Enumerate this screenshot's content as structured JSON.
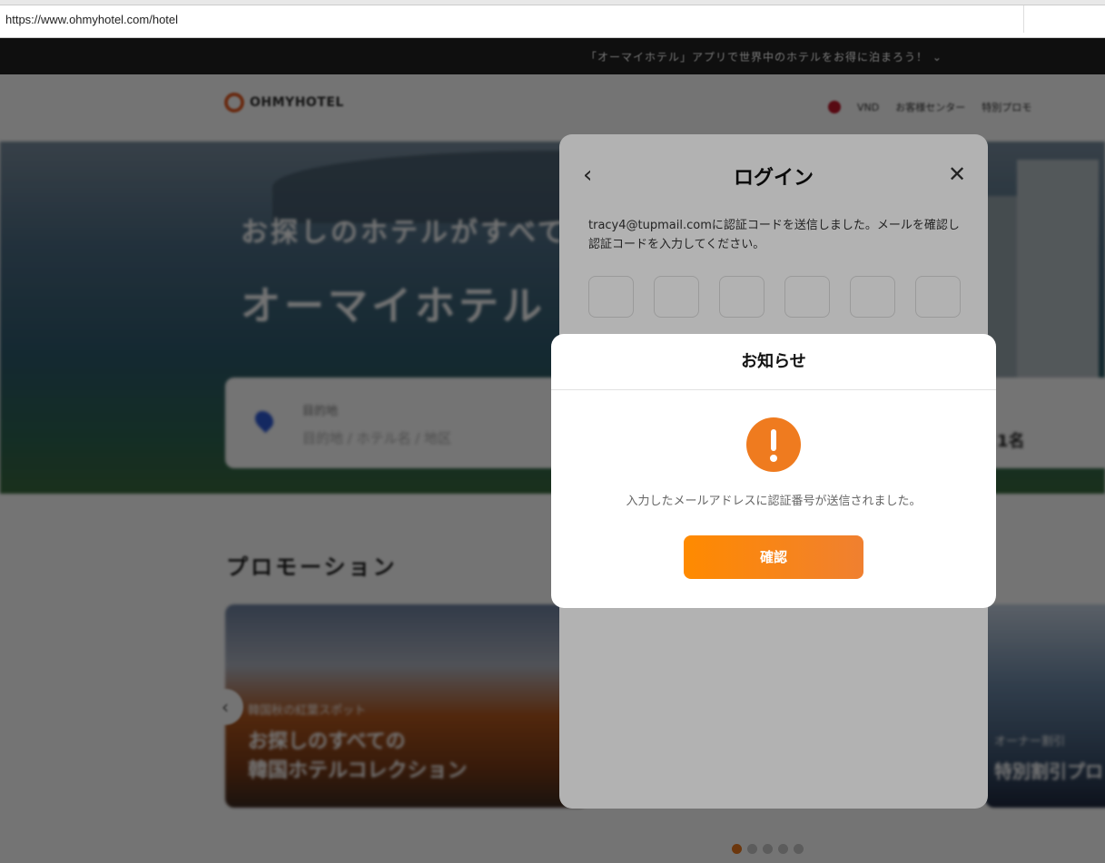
{
  "browser": {
    "url": "https://www.ohmyhotel.com/hotel"
  },
  "banner": {
    "text": "「オーマイホテル」アプリで世界中のホテルをお得に泊まろう！ ⌄"
  },
  "header": {
    "logo_text": "OHMYHOTEL",
    "currency": "VND",
    "nav_items": [
      "お客様センター",
      "特別プロモ"
    ]
  },
  "hero": {
    "subtitle": "お探しのホテルがすべて",
    "title": "オーマイホテル",
    "search": {
      "destination_label": "目的地",
      "destination_placeholder": "目的地 / ホテル名 / 地区",
      "guests": "1名"
    }
  },
  "promotion": {
    "heading": "プロモーション",
    "cards": [
      {
        "tag": "韓国秋の紅葉スポット",
        "title": "お探しのすべての\n韓国ホテルコレクション"
      },
      {
        "tag": "オーナー割引",
        "title": "特別割引プロ"
      }
    ]
  },
  "login_modal": {
    "back_icon": "chevron-left-icon",
    "title": "ログイン",
    "close_icon": "close-icon",
    "message": "tracy4@tupmail.comに認証コードを送信しました。メールを確認し認証コードを入力してください。",
    "code_boxes": [
      "",
      "",
      "",
      "",
      "",
      ""
    ]
  },
  "notice_dialog": {
    "title": "お知らせ",
    "icon": "exclamation-icon",
    "message": "入力したメールアドレスに認証番号が送信されました。",
    "confirm_label": "確認",
    "accent_color": "#ef7b1f"
  }
}
